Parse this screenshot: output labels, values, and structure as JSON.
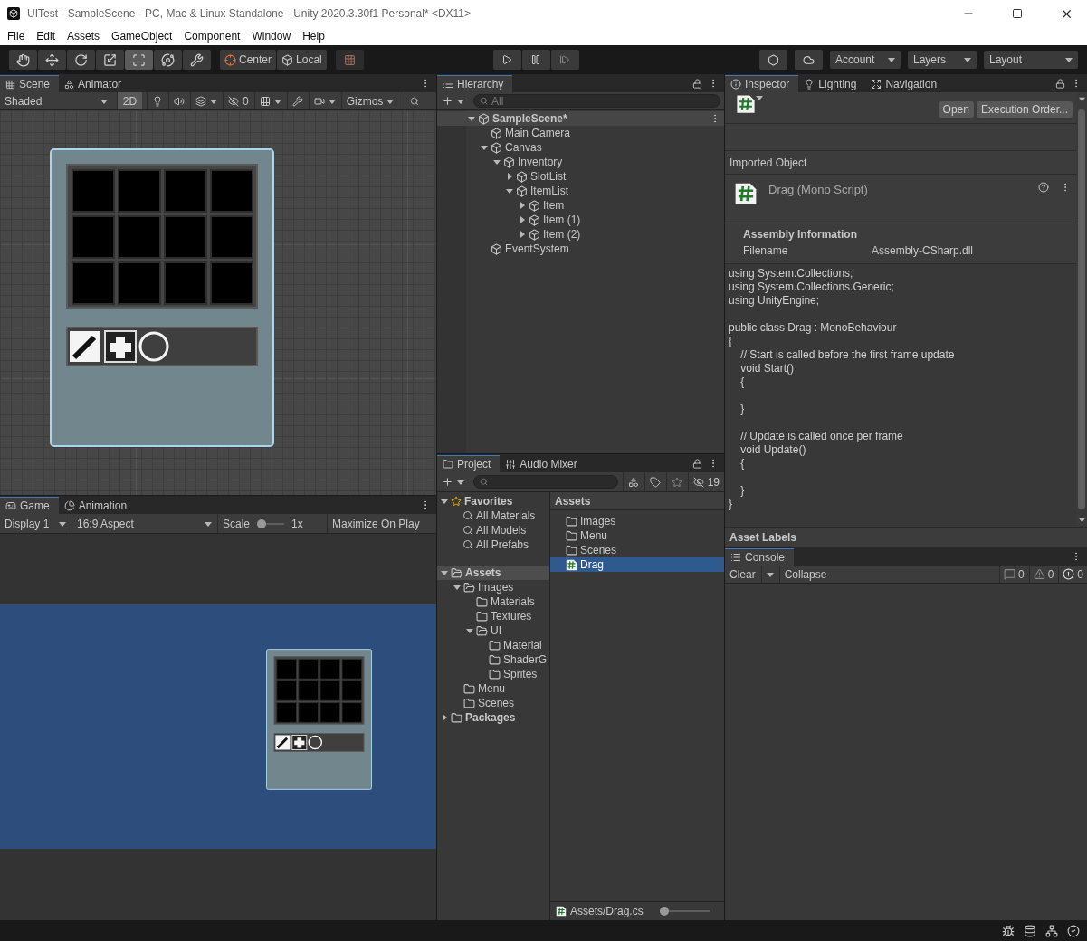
{
  "window": {
    "title": "UITest - SampleScene - PC, Mac & Linux Standalone - Unity 2020.3.30f1 Personal* <DX11>"
  },
  "menu": [
    "File",
    "Edit",
    "Assets",
    "GameObject",
    "Component",
    "Window",
    "Help"
  ],
  "toolbar": {
    "tools": [
      {
        "selected": false
      },
      {
        "selected": false
      },
      {
        "selected": false
      },
      {
        "selected": false
      },
      {
        "selected": true
      },
      {
        "selected": false
      },
      {
        "selected": false
      }
    ],
    "pivot": [
      "Center",
      "Local"
    ],
    "account": "Account",
    "layers": "Layers",
    "layout": "Layout"
  },
  "scene": {
    "tabs": [
      {
        "label": "Scene",
        "selected": true
      },
      {
        "label": "Animator",
        "selected": false
      }
    ],
    "shading": "Shaded",
    "mode_2d": {
      "label": "2D",
      "on": true
    },
    "hidden_count": "0",
    "gizmos": "Gizmos"
  },
  "game": {
    "tabs": [
      {
        "label": "Game",
        "selected": true
      },
      {
        "label": "Animation",
        "selected": false
      }
    ],
    "display": "Display 1",
    "aspect": "16:9 Aspect",
    "scale": {
      "label": "Scale",
      "level": 0,
      "reading": "1x"
    },
    "maximize": "Maximize On Play"
  },
  "hierarchy": {
    "tab": "Hierarchy",
    "search": {
      "placeholder": "All"
    },
    "tree": [
      {
        "label": "SampleScene*",
        "expanded": true,
        "children": [
          {
            "label": "Main Camera"
          },
          {
            "label": "Canvas",
            "expanded": true,
            "children": [
              {
                "label": "Inventory",
                "expanded": true,
                "children": [
                  {
                    "label": "SlotList",
                    "expanded": false
                  },
                  {
                    "label": "ItemList",
                    "expanded": true,
                    "children": [
                      {
                        "label": "Item",
                        "expanded": false
                      },
                      {
                        "label": "Item (1)",
                        "expanded": false
                      },
                      {
                        "label": "Item (2)",
                        "expanded": false
                      }
                    ]
                  }
                ]
              }
            ]
          },
          {
            "label": "EventSystem"
          }
        ]
      }
    ]
  },
  "project": {
    "tabs": [
      {
        "label": "Project",
        "selected": true
      },
      {
        "label": "Audio Mixer",
        "selected": false
      }
    ],
    "hidden_count": "19",
    "favorites": {
      "label": "Favorites",
      "expanded": true,
      "items": [
        "All Materials",
        "All Models",
        "All Prefabs"
      ]
    },
    "tree": [
      {
        "label": "Assets",
        "expanded": true,
        "selected": true,
        "children": [
          {
            "label": "Images",
            "expanded": true,
            "selected": false,
            "children": [
              {
                "label": "Materials",
                "selected": false
              },
              {
                "label": "Textures",
                "selected": false
              },
              {
                "label": "UI",
                "expanded": true,
                "selected": false,
                "children": [
                  {
                    "label": "Material",
                    "selected": false
                  },
                  {
                    "label": "ShaderG",
                    "selected": false
                  },
                  {
                    "label": "Sprites",
                    "selected": false
                  }
                ]
              }
            ]
          },
          {
            "label": "Menu",
            "selected": false
          },
          {
            "label": "Scenes",
            "selected": false
          }
        ]
      },
      {
        "label": "Packages",
        "expanded": false,
        "selected": false
      }
    ],
    "breadcrumb": "Assets",
    "items": [
      {
        "label": "Images",
        "kind": "folder",
        "selected": false
      },
      {
        "label": "Menu",
        "kind": "folder",
        "selected": false
      },
      {
        "label": "Scenes",
        "kind": "folder",
        "selected": false
      },
      {
        "label": "Drag",
        "kind": "script",
        "selected": true
      }
    ],
    "footer": {
      "path": "Assets/Drag.cs",
      "level": 0
    }
  },
  "inspector": {
    "tabs": [
      {
        "label": "Inspector",
        "selected": true
      },
      {
        "label": "Lighting",
        "selected": false
      },
      {
        "label": "Navigation",
        "selected": false
      }
    ],
    "buttons": [
      "Open",
      "Execution Order..."
    ],
    "section": "Imported Object",
    "asset": "Drag (Mono Script)",
    "assembly": {
      "heading": "Assembly Information",
      "label": "Filename",
      "value": "Assembly-CSharp.dll"
    },
    "code": [
      [
        "using System.Collections;",
        "using System.Collections.Generic;",
        "using UnityEngine;"
      ],
      [
        "public class Drag : MonoBehaviour",
        "{",
        "    // Start is called before the first frame update",
        "    void Start()",
        "    {"
      ],
      [
        "    }"
      ],
      [
        "    // Update is called once per frame",
        "    void Update()",
        "    {"
      ],
      [
        "    }",
        "}"
      ]
    ],
    "labels_heading": "Asset Labels"
  },
  "console": {
    "tab": "Console",
    "clear": "Clear",
    "collapse": "Collapse",
    "counts": [
      {
        "kind": "info",
        "count": "0"
      },
      {
        "kind": "warning",
        "count": "0"
      },
      {
        "kind": "error",
        "count": "0"
      }
    ]
  }
}
